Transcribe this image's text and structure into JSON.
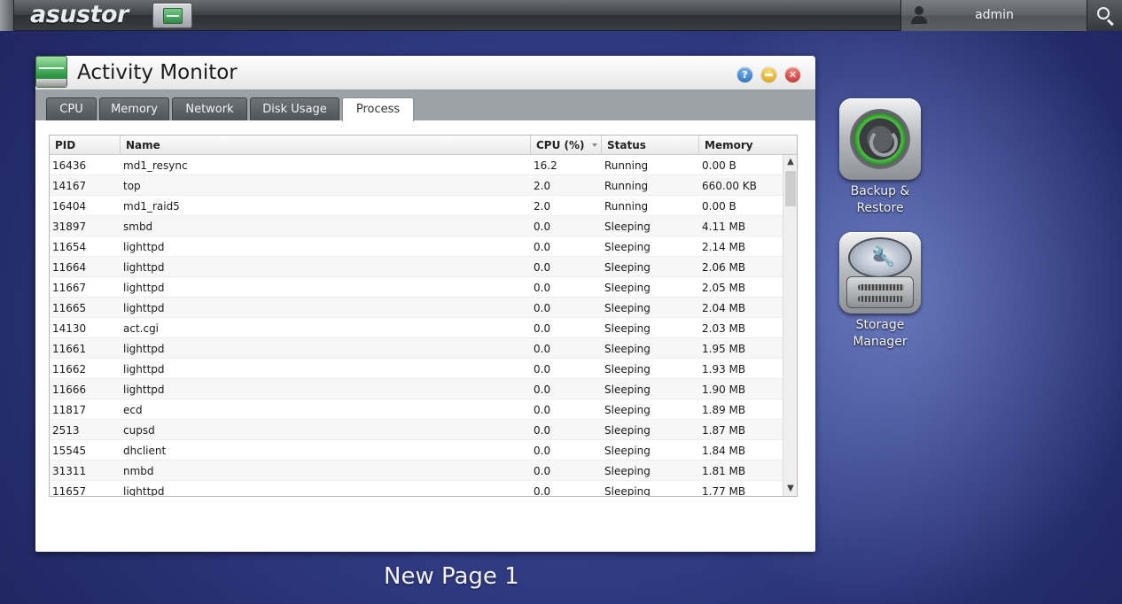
{
  "topbar": {
    "logo": "asustor",
    "username": "admin"
  },
  "window": {
    "title": "Activity Monitor",
    "help_glyph": "?",
    "close_glyph": "✕",
    "tabs": [
      {
        "label": "CPU"
      },
      {
        "label": "Memory"
      },
      {
        "label": "Network"
      },
      {
        "label": "Disk Usage"
      },
      {
        "label": "Process",
        "active": true
      }
    ]
  },
  "process_table": {
    "columns": {
      "pid": "PID",
      "name": "Name",
      "cpu": "CPU (%)",
      "status": "Status",
      "memory": "Memory"
    },
    "sort_column": "cpu",
    "rows": [
      {
        "pid": "16436",
        "name": "md1_resync",
        "cpu": "16.2",
        "status": "Running",
        "memory": "0.00 B"
      },
      {
        "pid": "14167",
        "name": "top",
        "cpu": "2.0",
        "status": "Running",
        "memory": "660.00 KB"
      },
      {
        "pid": "16404",
        "name": "md1_raid5",
        "cpu": "2.0",
        "status": "Running",
        "memory": "0.00 B"
      },
      {
        "pid": "31897",
        "name": "smbd",
        "cpu": "0.0",
        "status": "Sleeping",
        "memory": "4.11 MB"
      },
      {
        "pid": "11654",
        "name": "lighttpd",
        "cpu": "0.0",
        "status": "Sleeping",
        "memory": "2.14 MB"
      },
      {
        "pid": "11664",
        "name": "lighttpd",
        "cpu": "0.0",
        "status": "Sleeping",
        "memory": "2.06 MB"
      },
      {
        "pid": "11667",
        "name": "lighttpd",
        "cpu": "0.0",
        "status": "Sleeping",
        "memory": "2.05 MB"
      },
      {
        "pid": "11665",
        "name": "lighttpd",
        "cpu": "0.0",
        "status": "Sleeping",
        "memory": "2.04 MB"
      },
      {
        "pid": "14130",
        "name": "act.cgi",
        "cpu": "0.0",
        "status": "Sleeping",
        "memory": "2.03 MB"
      },
      {
        "pid": "11661",
        "name": "lighttpd",
        "cpu": "0.0",
        "status": "Sleeping",
        "memory": "1.95 MB"
      },
      {
        "pid": "11662",
        "name": "lighttpd",
        "cpu": "0.0",
        "status": "Sleeping",
        "memory": "1.93 MB"
      },
      {
        "pid": "11666",
        "name": "lighttpd",
        "cpu": "0.0",
        "status": "Sleeping",
        "memory": "1.90 MB"
      },
      {
        "pid": "11817",
        "name": "ecd",
        "cpu": "0.0",
        "status": "Sleeping",
        "memory": "1.89 MB"
      },
      {
        "pid": "2513",
        "name": "cupsd",
        "cpu": "0.0",
        "status": "Sleeping",
        "memory": "1.87 MB"
      },
      {
        "pid": "15545",
        "name": "dhclient",
        "cpu": "0.0",
        "status": "Sleeping",
        "memory": "1.84 MB"
      },
      {
        "pid": "31311",
        "name": "nmbd",
        "cpu": "0.0",
        "status": "Sleeping",
        "memory": "1.81 MB"
      },
      {
        "pid": "11657",
        "name": "lighttpd",
        "cpu": "0.0",
        "status": "Sleeping",
        "memory": "1.77 MB"
      }
    ]
  },
  "desktop": {
    "icons": [
      {
        "label": "Backup & Restore",
        "icon": "backup-restore-icon"
      },
      {
        "label": "Storage Manager",
        "icon": "storage-manager-icon"
      }
    ],
    "page_label": "New Page 1"
  },
  "colors": {
    "desktop_bg": "#2b3478",
    "tabbar_bg": "#9da1a8",
    "help": "#1e62b5",
    "minimize": "#d49a0f",
    "close": "#c0221b"
  }
}
